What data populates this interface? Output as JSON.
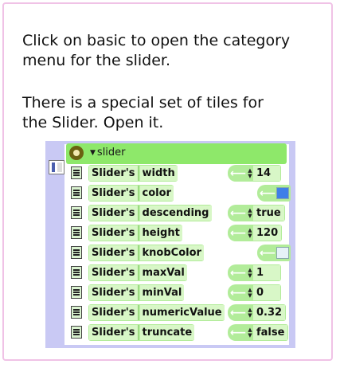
{
  "instructions": {
    "p1": "Click on basic to open the category\nmenu for the slider.",
    "p2": "There is a special set of tiles for\nthe Slider. Open it."
  },
  "viewer": {
    "category": "slider",
    "rows": [
      {
        "owner": "Slider's",
        "property": "width",
        "value": "14",
        "kind": "number"
      },
      {
        "owner": "Slider's",
        "property": "color",
        "value": "",
        "kind": "color",
        "swatch": "#3f7fe8"
      },
      {
        "owner": "Slider's",
        "property": "descending",
        "value": "true",
        "kind": "boolean"
      },
      {
        "owner": "Slider's",
        "property": "height",
        "value": "120",
        "kind": "number"
      },
      {
        "owner": "Slider's",
        "property": "knobColor",
        "value": "",
        "kind": "color",
        "swatch": "#e6f2f8"
      },
      {
        "owner": "Slider's",
        "property": "maxVal",
        "value": "1",
        "kind": "number"
      },
      {
        "owner": "Slider's",
        "property": "minVal",
        "value": "0",
        "kind": "number"
      },
      {
        "owner": "Slider's",
        "property": "numericValue",
        "value": "0.32",
        "kind": "number"
      },
      {
        "owner": "Slider's",
        "property": "truncate",
        "value": "false",
        "kind": "boolean"
      }
    ]
  },
  "colors": {
    "tile_green": "#b2ec9a",
    "header_green": "#8ee86a",
    "viewer_bg": "#c9c9f4",
    "frame_border": "#f0c2e6"
  }
}
